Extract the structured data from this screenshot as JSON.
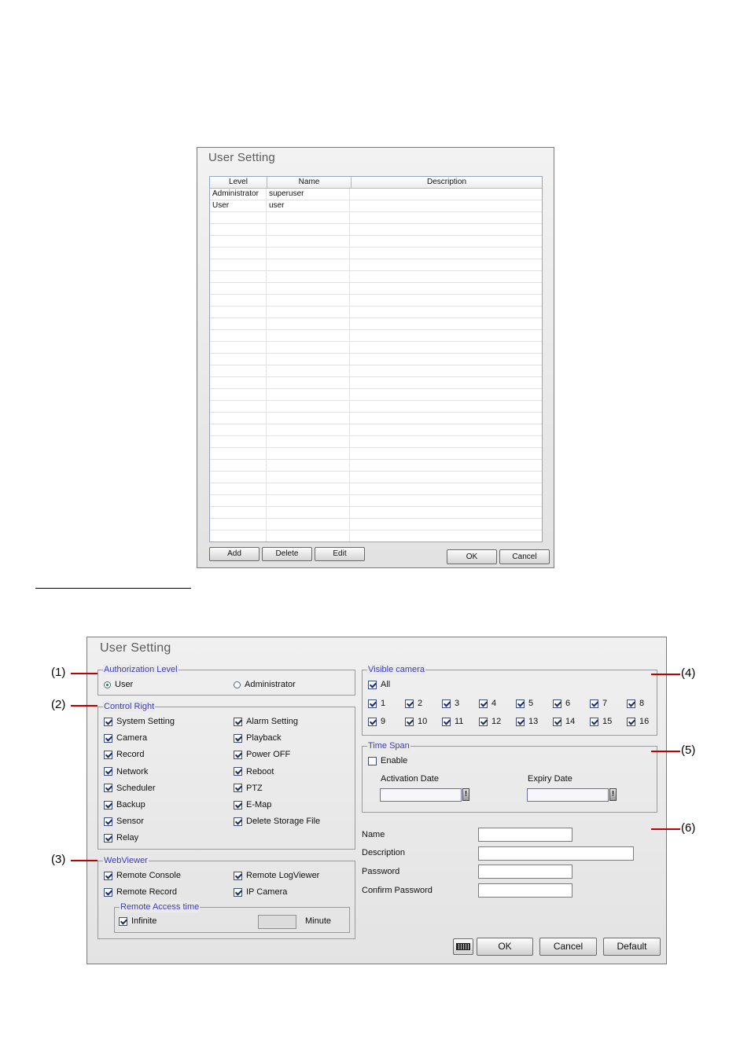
{
  "list_dialog": {
    "title": "User Setting",
    "columns": [
      "Level",
      "Name",
      "Description"
    ],
    "rows": [
      {
        "level": "Administrator",
        "name": "superuser",
        "description": ""
      },
      {
        "level": "User",
        "name": "user",
        "description": ""
      }
    ],
    "buttons": {
      "add": "Add",
      "delete": "Delete",
      "edit": "Edit",
      "ok": "OK",
      "cancel": "Cancel"
    }
  },
  "edit_dialog": {
    "title": "User Setting",
    "authorization_level": {
      "legend": "Authorization Level",
      "options": [
        {
          "label": "User",
          "selected": true
        },
        {
          "label": "Administrator",
          "selected": false
        }
      ]
    },
    "control_right": {
      "legend": "Control Right",
      "items": [
        {
          "label": "System Setting",
          "checked": true
        },
        {
          "label": "Alarm Setting",
          "checked": true
        },
        {
          "label": "Camera",
          "checked": true
        },
        {
          "label": "Playback",
          "checked": true
        },
        {
          "label": "Record",
          "checked": true
        },
        {
          "label": "Power OFF",
          "checked": true
        },
        {
          "label": "Network",
          "checked": true
        },
        {
          "label": "Reboot",
          "checked": true
        },
        {
          "label": "Scheduler",
          "checked": true
        },
        {
          "label": "PTZ",
          "checked": true
        },
        {
          "label": "Backup",
          "checked": true
        },
        {
          "label": "E-Map",
          "checked": true
        },
        {
          "label": "Sensor",
          "checked": true
        },
        {
          "label": "Delete Storage File",
          "checked": true
        },
        {
          "label": "Relay",
          "checked": true
        }
      ]
    },
    "webviewer": {
      "legend": "WebViewer",
      "items": [
        {
          "label": "Remote Console",
          "checked": true
        },
        {
          "label": "Remote LogViewer",
          "checked": true
        },
        {
          "label": "Remote Record",
          "checked": true
        },
        {
          "label": "IP Camera",
          "checked": true
        }
      ],
      "remote_access_time": {
        "legend": "Remote Access time",
        "infinite_label": "Infinite",
        "infinite_checked": true,
        "minute_value": "",
        "minute_label": "Minute"
      }
    },
    "visible_camera": {
      "legend": "Visible camera",
      "all_label": "All",
      "all_checked": true,
      "cameras": [
        "1",
        "2",
        "3",
        "4",
        "5",
        "6",
        "7",
        "8",
        "9",
        "10",
        "11",
        "12",
        "13",
        "14",
        "15",
        "16"
      ]
    },
    "time_span": {
      "legend": "Time Span",
      "enable_label": "Enable",
      "enable_checked": false,
      "activation_label": "Activation Date",
      "activation_value": "",
      "expiry_label": "Expiry Date",
      "expiry_value": "",
      "date_button": "!"
    },
    "account": {
      "name_label": "Name",
      "name_value": "",
      "description_label": "Description",
      "description_value": "",
      "password_label": "Password",
      "password_value": "",
      "confirm_label": "Confirm Password",
      "confirm_value": ""
    },
    "buttons": {
      "ok": "OK",
      "cancel": "Cancel",
      "default": "Default"
    },
    "keyboard_icon": "keyboard-icon"
  },
  "callouts": [
    "(1)",
    "(2)",
    "(3)",
    "(4)",
    "(5)",
    "(6)"
  ],
  "colors": {
    "legend_text": "#3b3bbb",
    "callout_line": "#c00000",
    "check_mark": "#1c2c66"
  }
}
